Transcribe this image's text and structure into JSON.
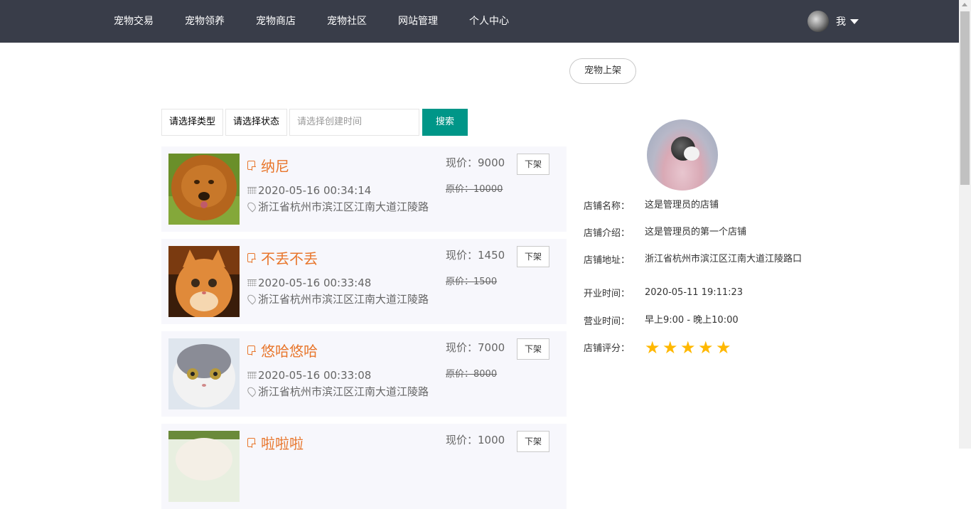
{
  "nav": {
    "items": [
      "宠物交易",
      "宠物领养",
      "宠物商店",
      "宠物社区",
      "网站管理",
      "个人中心"
    ],
    "user_label": "我"
  },
  "actions": {
    "list_pet": "宠物上架"
  },
  "filters": {
    "type_placeholder": "请选择类型",
    "status_placeholder": "请选择状态",
    "date_placeholder": "请选择创建时间",
    "search_label": "搜索"
  },
  "pets": [
    {
      "name": "纳尼",
      "date": "2020-05-16 00:34:14",
      "address": "浙江省杭州市滨江区江南大道江陵路",
      "price_now": "现价：9000",
      "price_old": "原价：10000",
      "off_label": "下架"
    },
    {
      "name": "不丢不丢",
      "date": "2020-05-16 00:33:48",
      "address": "浙江省杭州市滨江区江南大道江陵路",
      "price_now": "现价：1450",
      "price_old": "原价：1500",
      "off_label": "下架"
    },
    {
      "name": "悠哈悠哈",
      "date": "2020-05-16 00:33:08",
      "address": "浙江省杭州市滨江区江南大道江陵路",
      "price_now": "现价：7000",
      "price_old": "原价：8000",
      "off_label": "下架"
    },
    {
      "name": "啦啦啦",
      "date": "",
      "address": "",
      "price_now": "现价：1000",
      "price_old": "",
      "off_label": "下架"
    }
  ],
  "shop": {
    "name_label": "店铺名称：",
    "name": "这是管理员的店铺",
    "intro_label": "店铺介绍：",
    "intro": "这是管理员的第一个店铺",
    "address_label": "店铺地址：",
    "address": "浙江省杭州市滨江区江南大道江陵路口",
    "opened_label": "开业时间：",
    "opened": "2020-05-11 19:11:23",
    "hours_label": "营业时间：",
    "hours": "早上9:00 - 晚上10:00",
    "rating_label": "店铺评分：",
    "rating": 5,
    "rating_max": 5
  },
  "colors": {
    "topbar": "#393d49",
    "accent": "#009688",
    "name": "#e8762c",
    "star": "#ffb800"
  }
}
